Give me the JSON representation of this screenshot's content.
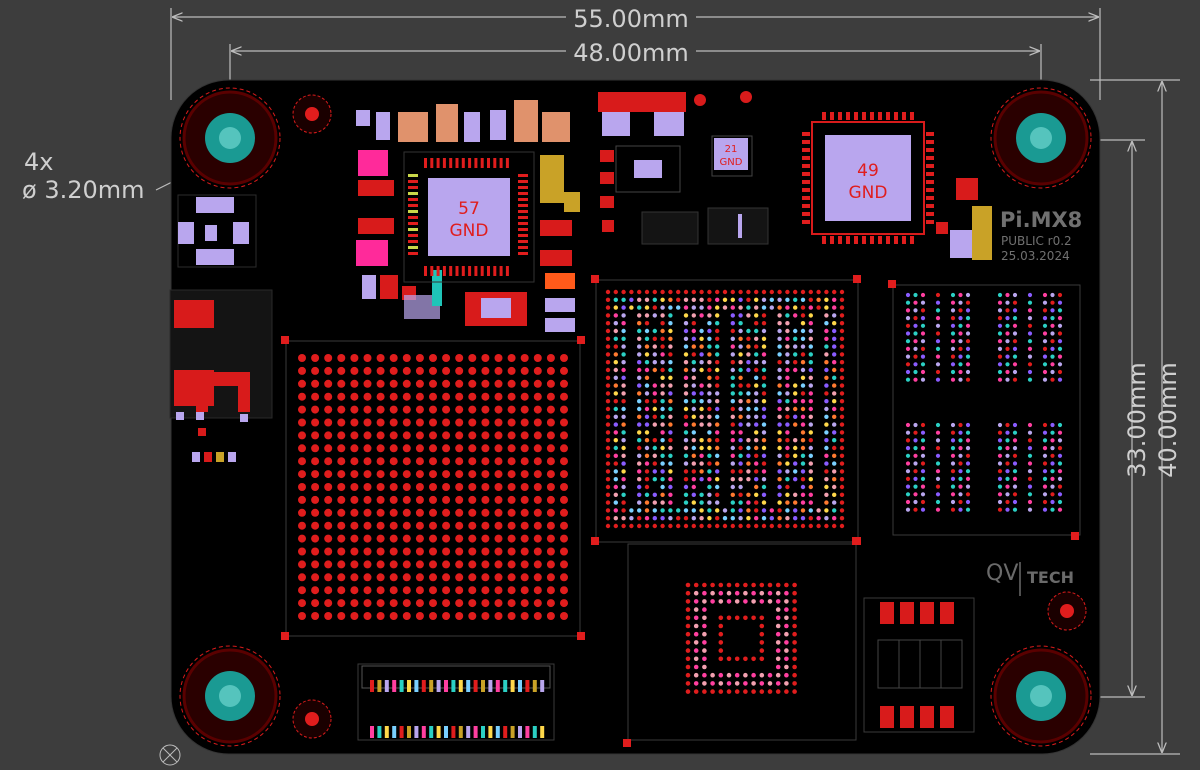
{
  "dimensions": {
    "width_overall": "55.00mm",
    "width_holes": "48.00mm",
    "height_holes": "33.00mm",
    "height_overall": "40.00mm",
    "hole_note_count": "4x",
    "hole_note_dia": "ø 3.20mm"
  },
  "silkscreen": {
    "product": "Pi.MX8",
    "revision": "PUBLIC r0.2",
    "date": "25.03.2024",
    "logo_letters": "QV",
    "logo_text": "TECH"
  },
  "pads": {
    "pmic": {
      "number": "57",
      "net": "GND"
    },
    "small_ic": {
      "number": "21",
      "net": "GND"
    },
    "right_ic": {
      "number": "49",
      "net": "GND"
    }
  },
  "colors": {
    "background": "#3d3d3d",
    "board": "#000000",
    "copper_pad": "#d81b1b",
    "hole_ring": "#d81b1b",
    "plated_hole": "#1a9a93",
    "exposed_pad": "#b9a6ee",
    "dimension_line": "#bdbdbd",
    "silkscreen": "#6a6a6a",
    "gold_finger": "#c9a227"
  }
}
